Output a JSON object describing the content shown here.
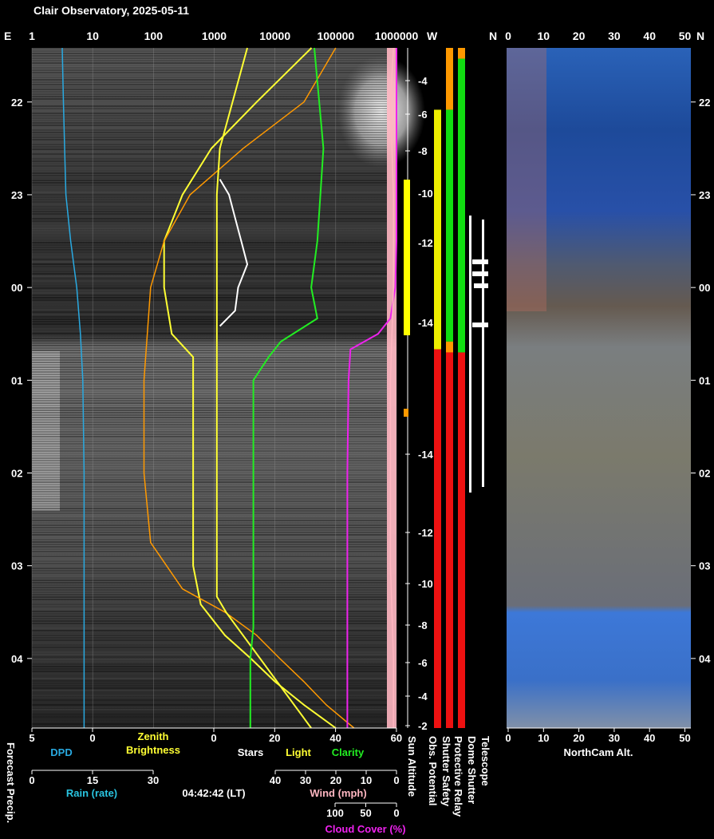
{
  "title": "Clair Observatory, 2025-05-11",
  "timestamp": "04:42:42 (LT)",
  "colors": {
    "dpd": "#29a9e0",
    "rain": "#29c4e0",
    "zenith": "#ffff33",
    "light": "#ffff33",
    "clarity": "#22ee22",
    "stars": "#ffffff",
    "wind": "#ffb6c1",
    "cloud": "#ee22ee",
    "sun_model": "#ff9900",
    "status_red": "#ee1111",
    "status_green": "#11dd11",
    "status_yellow": "#eeee00",
    "status_orange": "#ff9900"
  },
  "top_axis": {
    "left_end": "E",
    "right_end": "W",
    "ticks": [
      "1",
      "10",
      "100",
      "1000",
      "10000",
      "100000",
      "1000000"
    ]
  },
  "cam_top_axis": {
    "left_end": "N",
    "right_end": "N",
    "ticks": [
      "0",
      "10",
      "20",
      "30",
      "40",
      "50"
    ]
  },
  "time_axis": {
    "left_labels": [
      "22",
      "23",
      "00",
      "01",
      "02",
      "03",
      "04"
    ],
    "right_labels": [
      "22",
      "23",
      "00",
      "01",
      "02",
      "03",
      "04"
    ]
  },
  "sun_altitude_labels": [
    "-4",
    "-6",
    "-8",
    "-10",
    "-12",
    "-14",
    "-14",
    "-12",
    "-10",
    "-8",
    "-6",
    "-4",
    "-2"
  ],
  "bottom_axes": {
    "dpd_ticks": [
      "5",
      "0"
    ],
    "dpd_label": "DPD",
    "zenith_label_1": "Zenith",
    "zenith_label_2": "Brightness",
    "scale_ticks": [
      "0",
      "20",
      "40",
      "60"
    ],
    "stars_label": "Stars",
    "light_label": "Light",
    "clarity_label": "Clarity",
    "forecast_label": "Forecast Precip.",
    "rain_ticks": [
      "0",
      "15",
      "30"
    ],
    "rain_label": "Rain (rate)",
    "wind_ticks": [
      "40",
      "30",
      "20",
      "10",
      "0"
    ],
    "wind_label": "Wind (mph)",
    "cloud_ticks": [
      "100",
      "50",
      "0"
    ],
    "cloud_label": "Cloud Cover (%)",
    "status_labels": [
      "Sun Altitude",
      "Obs. Potential",
      "Shutter Safety",
      "Protective Relay",
      "Dome Shutter",
      "Telescope"
    ],
    "cam_ticks": [
      "0",
      "10",
      "20",
      "30",
      "40",
      "50"
    ],
    "cam_label": "NorthCam Alt."
  },
  "chart_data": {
    "type": "line",
    "title": "Clair Observatory, 2025-05-11",
    "time_range": [
      "21:25",
      "04:45"
    ],
    "x_scale": "log",
    "xlim": [
      1,
      1000000
    ],
    "series": [
      {
        "name": "Zenith Brightness",
        "time": [
          "21:25",
          "22:00",
          "22:30",
          "23:00",
          "23:30",
          "00:00",
          "00:30",
          "00:45",
          "01:00",
          "02:00",
          "03:00",
          "03:25",
          "03:45",
          "04:00",
          "04:15",
          "04:30",
          "04:45"
        ],
        "values": [
          40000,
          5000,
          900,
          300,
          150,
          150,
          200,
          450,
          450,
          450,
          450,
          600,
          1500,
          4000,
          10000,
          30000,
          100000
        ]
      },
      {
        "name": "Light",
        "time": [
          "21:25",
          "22:30",
          "23:00",
          "00:00",
          "00:45",
          "02:00",
          "03:20",
          "03:30",
          "04:45"
        ],
        "values": [
          11,
          2,
          1,
          1,
          1,
          1,
          1,
          4,
          32
        ]
      },
      {
        "name": "Clarity",
        "time": [
          "21:25",
          "22:30",
          "23:30",
          "00:00",
          "00:20",
          "00:35",
          "00:45",
          "01:00",
          "02:00",
          "03:00",
          "03:40",
          "04:00",
          "04:45"
        ],
        "values": [
          33,
          36,
          34,
          32,
          34,
          22,
          18,
          13,
          13,
          13,
          13,
          12,
          12
        ]
      },
      {
        "name": "Stars",
        "time": [
          "22:50",
          "23:00",
          "23:15",
          "23:30",
          "23:45",
          "00:00",
          "00:15",
          "00:25"
        ],
        "values": [
          2,
          5,
          7,
          9,
          11,
          8,
          7,
          2
        ]
      },
      {
        "name": "Cloud Cover (%)",
        "time": [
          "21:25",
          "22:00",
          "22:30",
          "23:00",
          "23:30",
          "00:00",
          "00:20",
          "00:30",
          "00:40",
          "01:00",
          "02:00",
          "03:00",
          "04:00",
          "04:45"
        ],
        "values": [
          0,
          0,
          0,
          0,
          0,
          2,
          10,
          30,
          75,
          78,
          80,
          80,
          80,
          80
        ]
      },
      {
        "name": "DPD",
        "time": [
          "21:25",
          "22:00",
          "22:30",
          "23:00",
          "23:30",
          "00:00",
          "00:30",
          "01:00",
          "02:00",
          "03:00",
          "04:00",
          "04:45"
        ],
        "values": [
          2.5,
          2.4,
          2.3,
          2.2,
          1.8,
          1.3,
          1.0,
          0.8,
          0.7,
          0.7,
          0.7,
          0.7
        ]
      },
      {
        "name": "Wind (mph)",
        "time": [
          "21:25",
          "22:00",
          "23:00",
          "00:00",
          "01:00",
          "02:00",
          "03:00",
          "04:00",
          "04:45"
        ],
        "values": [
          1,
          2,
          1,
          1,
          2,
          2,
          2,
          1,
          1
        ]
      }
    ],
    "status_bars": [
      {
        "name": "Sun Altitude",
        "segments": [
          {
            "from": "21:25",
            "to": "22:05",
            "color": "black"
          },
          {
            "from": "22:05",
            "to": "00:40",
            "color": "yellow"
          },
          {
            "from": "00:40",
            "to": "04:45",
            "color": "red"
          }
        ]
      },
      {
        "name": "Obs. Potential",
        "segments": [
          {
            "from": "21:25",
            "to": "22:05",
            "color": "orange"
          },
          {
            "from": "22:05",
            "to": "00:35",
            "color": "green"
          },
          {
            "from": "00:35",
            "to": "00:42",
            "color": "orange"
          },
          {
            "from": "00:42",
            "to": "04:45",
            "color": "red"
          }
        ]
      },
      {
        "name": "Shutter Safety",
        "segments": [
          {
            "from": "21:25",
            "to": "21:32",
            "color": "orange"
          },
          {
            "from": "21:32",
            "to": "00:42",
            "color": "green"
          },
          {
            "from": "00:42",
            "to": "04:45",
            "color": "red"
          }
        ]
      }
    ],
    "ylabel_left": "E",
    "ylabel_right": "W"
  }
}
